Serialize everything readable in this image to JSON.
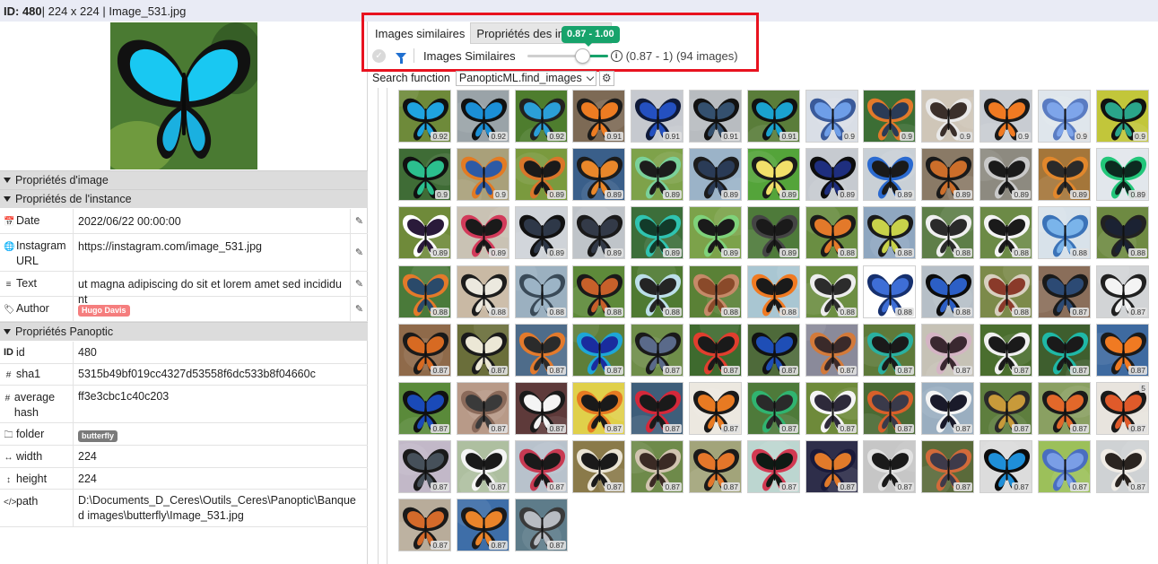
{
  "header": {
    "id_label": "ID: 480",
    "rest": " | 224 x 224 | Image_531.jpg"
  },
  "sections": {
    "image_props": "Propriétés d'image",
    "instance_props": "Propriétés de l'instance",
    "panoptic_props": "Propriétés Panoptic"
  },
  "instance": {
    "date_key": "Date",
    "date_val": "2022/06/22 00:00:00",
    "insta_key": "Instagram URL",
    "insta_val": "https://instagram.com/image_531.jpg",
    "text_key": "Text",
    "text_val": "ut magna adipiscing do sit et lorem amet sed incididunt",
    "author_key": "Author",
    "author_val": "Hugo Davis"
  },
  "panoptic": {
    "id_key_icon": "ID",
    "id_key": "id",
    "id_val": "480",
    "sha1_key": "sha1",
    "sha1_val": "5315b49bf019cc4327d53558f6dc533b8f04660c",
    "ahash_key": "average hash",
    "ahash_val": "ff3e3cbc1c40c203",
    "folder_key": "folder",
    "folder_val": "butterfly",
    "width_key": "width",
    "width_val": "224",
    "height_key": "height",
    "height_val": "224",
    "path_key": "path",
    "path_val": "D:\\Documents_D_Ceres\\Outils_Ceres\\Panoptic\\Banque d images\\butterfly\\Image_531.jpg"
  },
  "tabs": {
    "similar": "Images similaires",
    "props": "Propriétés des images"
  },
  "filter": {
    "tooltip": "0.87 - 1.00",
    "label": "Images Similaires",
    "range_text": "(0.87 - 1)  (94 images)",
    "slider_value": 0.87
  },
  "search": {
    "label": "Search function",
    "value": "PanopticML.find_images"
  },
  "colors": {
    "accent": "#17a36b",
    "highlight": "#e8121f",
    "author_tag": "#f57e7e"
  },
  "results": [
    {
      "score": "0.92",
      "bg": "#6e8a3a",
      "wing": "#1fa3e0",
      "edge": "#111"
    },
    {
      "score": "0.92",
      "bg": "#9aa3a8",
      "wing": "#1b8fd6",
      "edge": "#111"
    },
    {
      "score": "0.92",
      "bg": "#4e7d2e",
      "wing": "#2b9fd8",
      "edge": "#222"
    },
    {
      "score": "0.91",
      "bg": "#7d6a55",
      "wing": "#ed7c22",
      "edge": "#1b1b1b"
    },
    {
      "score": "0.91",
      "bg": "#c6c9cf",
      "wing": "#2450c0",
      "edge": "#0f1a3a"
    },
    {
      "score": "0.91",
      "bg": "#b8bcc0",
      "wing": "#34506e",
      "edge": "#111"
    },
    {
      "score": "0.91",
      "bg": "#5a7d3a",
      "wing": "#1aa2cf",
      "edge": "#111"
    },
    {
      "score": "0.9",
      "bg": "#d9dee6",
      "wing": "#6e9ee8",
      "edge": "#3a5a9a"
    },
    {
      "score": "0.9",
      "bg": "#3c6e35",
      "wing": "#2a3b56",
      "edge": "#e2792a"
    },
    {
      "score": "0.9",
      "bg": "#cfc6b8",
      "wing": "#3a2f2a",
      "edge": "#e9e9e9"
    },
    {
      "score": "0.9",
      "bg": "#c8ccd2",
      "wing": "#f07a22",
      "edge": "#1a1a1a"
    },
    {
      "score": "0.9",
      "bg": "#dfe6ec",
      "wing": "#7ea5ea",
      "edge": "#5a7cc2"
    },
    {
      "score": "0.9",
      "bg": "#c2c63a",
      "wing": "#2aa58a",
      "edge": "#111"
    },
    {
      "score": "0.9",
      "bg": "#3f6c36",
      "wing": "#2bbf8e",
      "edge": "#111"
    },
    {
      "score": "0.9",
      "bg": "#a9a07a",
      "wing": "#2d5aa6",
      "edge": "#e27b24"
    },
    {
      "score": "0.89",
      "bg": "#7a9a3e",
      "wing": "#1a1a1a",
      "edge": "#d9752a"
    },
    {
      "score": "0.89",
      "bg": "#3a5f8a",
      "wing": "#e9872a",
      "edge": "#1c1c1c"
    },
    {
      "score": "0.89",
      "bg": "#7ea24a",
      "wing": "#1c1c1c",
      "edge": "#7ad19a"
    },
    {
      "score": "0.89",
      "bg": "#9bb3c8",
      "wing": "#2a3b56",
      "edge": "#1c1c1c"
    },
    {
      "score": "0.89",
      "bg": "#54a43a",
      "wing": "#f1e06a",
      "edge": "#1a1a1a"
    },
    {
      "score": "0.89",
      "bg": "#c6cad0",
      "wing": "#1e2e7e",
      "edge": "#0d0d0d"
    },
    {
      "score": "0.89",
      "bg": "#c9d0d6",
      "wing": "#1a1a1a",
      "edge": "#2a6ad0"
    },
    {
      "score": "0.89",
      "bg": "#8a7a66",
      "wing": "#cc6e2a",
      "edge": "#1a1a1a"
    },
    {
      "score": "0.89",
      "bg": "#8d8a80",
      "wing": "#1a1a1a",
      "edge": "#c9c9c9"
    },
    {
      "score": "0.89",
      "bg": "#a4763a",
      "wing": "#2a2a2a",
      "edge": "#e1872c"
    },
    {
      "score": "0.89",
      "bg": "#e2e7ec",
      "wing": "#0c2a20",
      "edge": "#22c67a"
    },
    {
      "score": "0.89",
      "bg": "#6f8a3a",
      "wing": "#2a1a3a",
      "edge": "#ffffff"
    },
    {
      "score": "0.89",
      "bg": "#c9c2b4",
      "wing": "#1a1a1a",
      "edge": "#d23a5a"
    },
    {
      "score": "0.89",
      "bg": "#cfd3d8",
      "wing": "#2e3848",
      "edge": "#111"
    },
    {
      "score": "0.89",
      "bg": "#bfc4c9",
      "wing": "#333a48",
      "edge": "#1a1a1a"
    },
    {
      "score": "0.89",
      "bg": "#3c6e3a",
      "wing": "#123b2a",
      "edge": "#2fc3b0"
    },
    {
      "score": "0.89",
      "bg": "#7ca24a",
      "wing": "#1a1a1a",
      "edge": "#7fd27a"
    },
    {
      "score": "0.89",
      "bg": "#4e7a3a",
      "wing": "#1a1a1a",
      "edge": "#444"
    },
    {
      "score": "0.88",
      "bg": "#6a8e42",
      "wing": "#e3792a",
      "edge": "#1a1a1a"
    },
    {
      "score": "0.88",
      "bg": "#8fa7c0",
      "wing": "#c8d24a",
      "edge": "#1a1a1a"
    },
    {
      "score": "0.88",
      "bg": "#5e7e48",
      "wing": "#2a2a2a",
      "edge": "#f0f0f0"
    },
    {
      "score": "0.88",
      "bg": "#6c8a46",
      "wing": "#1a1a1a",
      "edge": "#f4f4f4"
    },
    {
      "score": "0.88",
      "bg": "#d8e2ea",
      "wing": "#7ab4ea",
      "edge": "#3b73b8"
    },
    {
      "score": "0.88",
      "bg": "#6e8a42",
      "wing": "#1b2233",
      "edge": "#222"
    },
    {
      "score": "0.88",
      "bg": "#4a7a3a",
      "wing": "#2a4a6a",
      "edge": "#e37a2a"
    },
    {
      "score": "0.88",
      "bg": "#c9b9a4",
      "wing": "#ece9df",
      "edge": "#1c1c1c"
    },
    {
      "score": "0.88",
      "bg": "#9bb0c0",
      "wing": "#9cb4c6",
      "edge": "#3a4a58"
    },
    {
      "score": "0.88",
      "bg": "#5e8a3a",
      "wing": "#c7602a",
      "edge": "#1a1a1a"
    },
    {
      "score": "0.88",
      "bg": "#4f7a32",
      "wing": "#242424",
      "edge": "#bcdfe9"
    },
    {
      "score": "0.88",
      "bg": "#5a8136",
      "wing": "#8a4a2a",
      "edge": "#c58a68"
    },
    {
      "score": "0.88",
      "bg": "#a9c6d2",
      "wing": "#1a1a1a",
      "edge": "#f07a22"
    },
    {
      "score": "0.88",
      "bg": "#6c8e42",
      "wing": "#2c2c2c",
      "edge": "#ededed"
    },
    {
      "score": "0.88",
      "bg": "#ffffff",
      "wing": "#3e6ed6",
      "edge": "#16306e"
    },
    {
      "score": "0.88",
      "bg": "#b6bfc7",
      "wing": "#2c5fc6",
      "edge": "#0c0c0c"
    },
    {
      "score": "0.88",
      "bg": "#7c8a4a",
      "wing": "#8a3a2a",
      "edge": "#d8d0c0"
    },
    {
      "score": "0.87",
      "bg": "#8a6e5a",
      "wing": "#2c4a74",
      "edge": "#1a1a1a"
    },
    {
      "score": "0.87",
      "bg": "#d2d4d6",
      "wing": "#f4f4f4",
      "edge": "#202020"
    },
    {
      "score": "0.87",
      "bg": "#8f6a4a",
      "wing": "#d76a22",
      "edge": "#1a1a1a"
    },
    {
      "score": "0.87",
      "bg": "#6a6e3a",
      "wing": "#ece8d6",
      "edge": "#1a1a1a"
    },
    {
      "score": "0.87",
      "bg": "#4e6c8a",
      "wing": "#2b2b2b",
      "edge": "#e37a2c"
    },
    {
      "score": "0.87",
      "bg": "#5e7e3a",
      "wing": "#1a2c9e",
      "edge": "#1ea6d6"
    },
    {
      "score": "0.87",
      "bg": "#6f8e4a",
      "wing": "#5a6a8a",
      "edge": "#1a1a1a"
    },
    {
      "score": "0.87",
      "bg": "#3e6a2e",
      "wing": "#1a1a1a",
      "edge": "#e03e2e"
    },
    {
      "score": "0.87",
      "bg": "#4e6a3a",
      "wing": "#1e4eb6",
      "edge": "#111"
    },
    {
      "score": "0.87",
      "bg": "#8a8a9a",
      "wing": "#3a2a2a",
      "edge": "#d37a3a"
    },
    {
      "score": "0.87",
      "bg": "#5e7a3a",
      "wing": "#1a1a1a",
      "edge": "#2ab0a0"
    },
    {
      "score": "0.87",
      "bg": "#c6c2b6",
      "wing": "#3a2830",
      "edge": "#d4b4c4"
    },
    {
      "score": "0.87",
      "bg": "#4a6e2e",
      "wing": "#1a1a1a",
      "edge": "#f0f0f0"
    },
    {
      "score": "0.87",
      "bg": "#3e5e2e",
      "wing": "#1a1a1a",
      "edge": "#1fb8a6"
    },
    {
      "score": "0.87",
      "bg": "#3e6aa0",
      "wing": "#f07a22",
      "edge": "#1a1a1a"
    },
    {
      "score": "0.87",
      "bg": "#5a8a3a",
      "wing": "#1a4ab8",
      "edge": "#111"
    },
    {
      "score": "0.87",
      "bg": "#b89a88",
      "wing": "#3a3a3a",
      "edge": "#8a6a5a"
    },
    {
      "score": "0.87",
      "bg": "#5e3a3a",
      "wing": "#f4f4f4",
      "edge": "#1a1a1a"
    },
    {
      "score": "0.87",
      "bg": "#e0d04a",
      "wing": "#1a1a1a",
      "edge": "#e67a22"
    },
    {
      "score": "0.87",
      "bg": "#3e5e7a",
      "wing": "#1a1a1a",
      "edge": "#d4283a"
    },
    {
      "score": "0.87",
      "bg": "#ece8e0",
      "wing": "#e87a22",
      "edge": "#1a1a1a"
    },
    {
      "score": "0.87",
      "bg": "#4e7a3a",
      "wing": "#2a2a2a",
      "edge": "#30b470"
    },
    {
      "score": "0.87",
      "bg": "#6e8a3a",
      "wing": "#2e2a3a",
      "edge": "#f4f4f4"
    },
    {
      "score": "0.87",
      "bg": "#4a6a34",
      "wing": "#3a3a4a",
      "edge": "#d8602a"
    },
    {
      "score": "0.87",
      "bg": "#9aaec0",
      "wing": "#1a1a2a",
      "edge": "#f4f4f4"
    },
    {
      "score": "0.87",
      "bg": "#5e7e3e",
      "wing": "#c89a3a",
      "edge": "#2a2a2a"
    },
    {
      "score": "0.87",
      "bg": "#8aa062",
      "wing": "#e2682a",
      "edge": "#1a1a1a"
    },
    {
      "score": "0.87",
      "bg": "#e8e4de",
      "wing": "#e05a2a",
      "edge": "#1a1a1a",
      "count": "5"
    },
    {
      "score": "0.87",
      "bg": "#c2b8c8",
      "wing": "#46505a",
      "edge": "#1a1a1a"
    },
    {
      "score": "0.87",
      "bg": "#aebfa0",
      "wing": "#1a1a1a",
      "edge": "#f4f4f4"
    },
    {
      "score": "0.87",
      "bg": "#b8c2cc",
      "wing": "#1a1a1a",
      "edge": "#c83a52"
    },
    {
      "score": "0.87",
      "bg": "#8a7a4a",
      "wing": "#1a1a1a",
      "edge": "#eae4d4"
    },
    {
      "score": "0.87",
      "bg": "#6e8a4a",
      "wing": "#3a2a24",
      "edge": "#d1c4b0"
    },
    {
      "score": "0.87",
      "bg": "#a2a47a",
      "wing": "#e4762a",
      "edge": "#1a1a1a"
    },
    {
      "score": "0.87",
      "bg": "#bcd6d0",
      "wing": "#0e1a14",
      "edge": "#d23a52"
    },
    {
      "score": "0.87",
      "bg": "#2e2e4a",
      "wing": "#e27a2a",
      "edge": "#1a1a3a"
    },
    {
      "score": "0.87",
      "bg": "#c6c6c6",
      "wing": "#1a1a1a",
      "edge": "#e2e2e2"
    },
    {
      "score": "0.87",
      "bg": "#5a6a3a",
      "wing": "#3e3a4a",
      "edge": "#d26a3a"
    },
    {
      "score": "0.87",
      "bg": "#dcdcdc",
      "wing": "#1f8fd8",
      "edge": "#0c0c0c"
    },
    {
      "score": "0.87",
      "bg": "#9cc05a",
      "wing": "#7a9ee6",
      "edge": "#4a6ec0"
    },
    {
      "score": "0.87",
      "bg": "#cfd2d4",
      "wing": "#2a2420",
      "edge": "#f0ece6"
    },
    {
      "score": "0.87",
      "bg": "#b8ac9a",
      "wing": "#d46a2a",
      "edge": "#1a1a1a"
    },
    {
      "score": "0.87",
      "bg": "#3e6ea8",
      "wing": "#ea842a",
      "edge": "#1a1a1a"
    },
    {
      "score": "0.87",
      "bg": "#5e7c8a",
      "wing": "#b8bcc2",
      "edge": "#3a3a3a"
    }
  ]
}
